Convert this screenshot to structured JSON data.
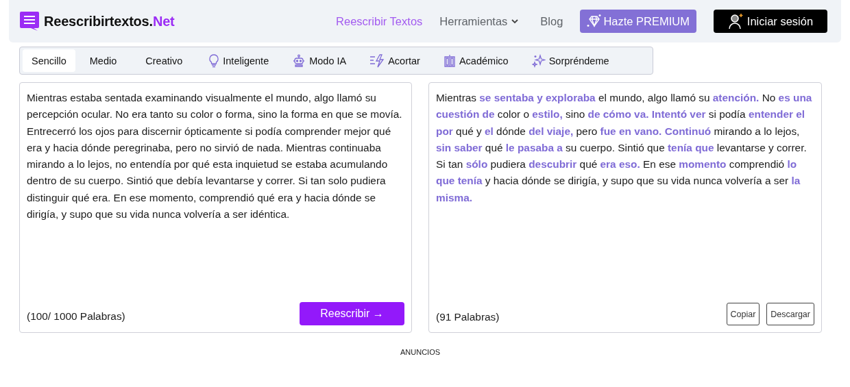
{
  "header": {
    "logo": {
      "name": "Reescribirtextos.",
      "suffix": "Net"
    },
    "nav": [
      {
        "label": "Reescribir Textos",
        "selected": true,
        "kind": "link"
      },
      {
        "label": "Herramientas",
        "selected": false,
        "kind": "dropdown"
      },
      {
        "label": "Blog",
        "selected": false,
        "kind": "link"
      }
    ],
    "premium_button": "Hazte PREMIUM",
    "login_button": "Iniciar sesión"
  },
  "modes": [
    {
      "label": "Sencillo",
      "selected": true
    },
    {
      "label": "Medio",
      "selected": false
    },
    {
      "label": "Creativo",
      "selected": false
    },
    {
      "label": "Inteligente",
      "selected": false
    },
    {
      "label": "Modo IA",
      "selected": false
    },
    {
      "label": "Acortar",
      "selected": false
    },
    {
      "label": "Académico",
      "selected": false
    },
    {
      "label": "Sorpréndeme",
      "selected": false
    }
  ],
  "input": {
    "text": "Mientras estaba sentada examinando visualmente el mundo, algo llamó su percepción ocular. No era tanto su color o forma, sino la forma en que se movía. Entrecerró los ojos para discernir ópticamente si podía comprender mejor qué era y hacia dónde peregrinaba, pero no sirvió de nada. Mientras continuaba mirando a lo lejos, no entendía por qué esta inquietud se estaba acumulando dentro de su cuerpo. Sintió que debía levantarse y correr. Si tan solo pudiera distinguir qué era. En ese momento, comprendió qué era y hacia dónde se dirigía, y supo que su vida nunca volvería a ser idéntica.",
    "count": "(100/ 1000 Palabras)",
    "button": "Reescribir →"
  },
  "output": {
    "text": "Mientras **se sentaba y exploraba** el mundo, algo llamó su **atención.** No **es una cuestión de** color o **estilo,** sino **de cómo va. Intentó ver** si podía **entender el por** qué y **el** dónde **del viaje,** pero **fue en vano. Continuó** mirando a lo lejos, **sin saber** qué **le pasaba a** su cuerpo. Sintió que **tenía que** levantarse y correr. Si tan **sólo** pudiera **descubrir** qué **era eso.** En ese **momento** comprendió **lo que tenía** y hacia dónde se dirigía, y supo que su vida nunca volvería a ser **la misma.**",
    "count": "(91 Palabras)",
    "buttons": [
      "Copiar",
      "Descargar"
    ]
  },
  "ads_label": "ANUNCIOS"
}
